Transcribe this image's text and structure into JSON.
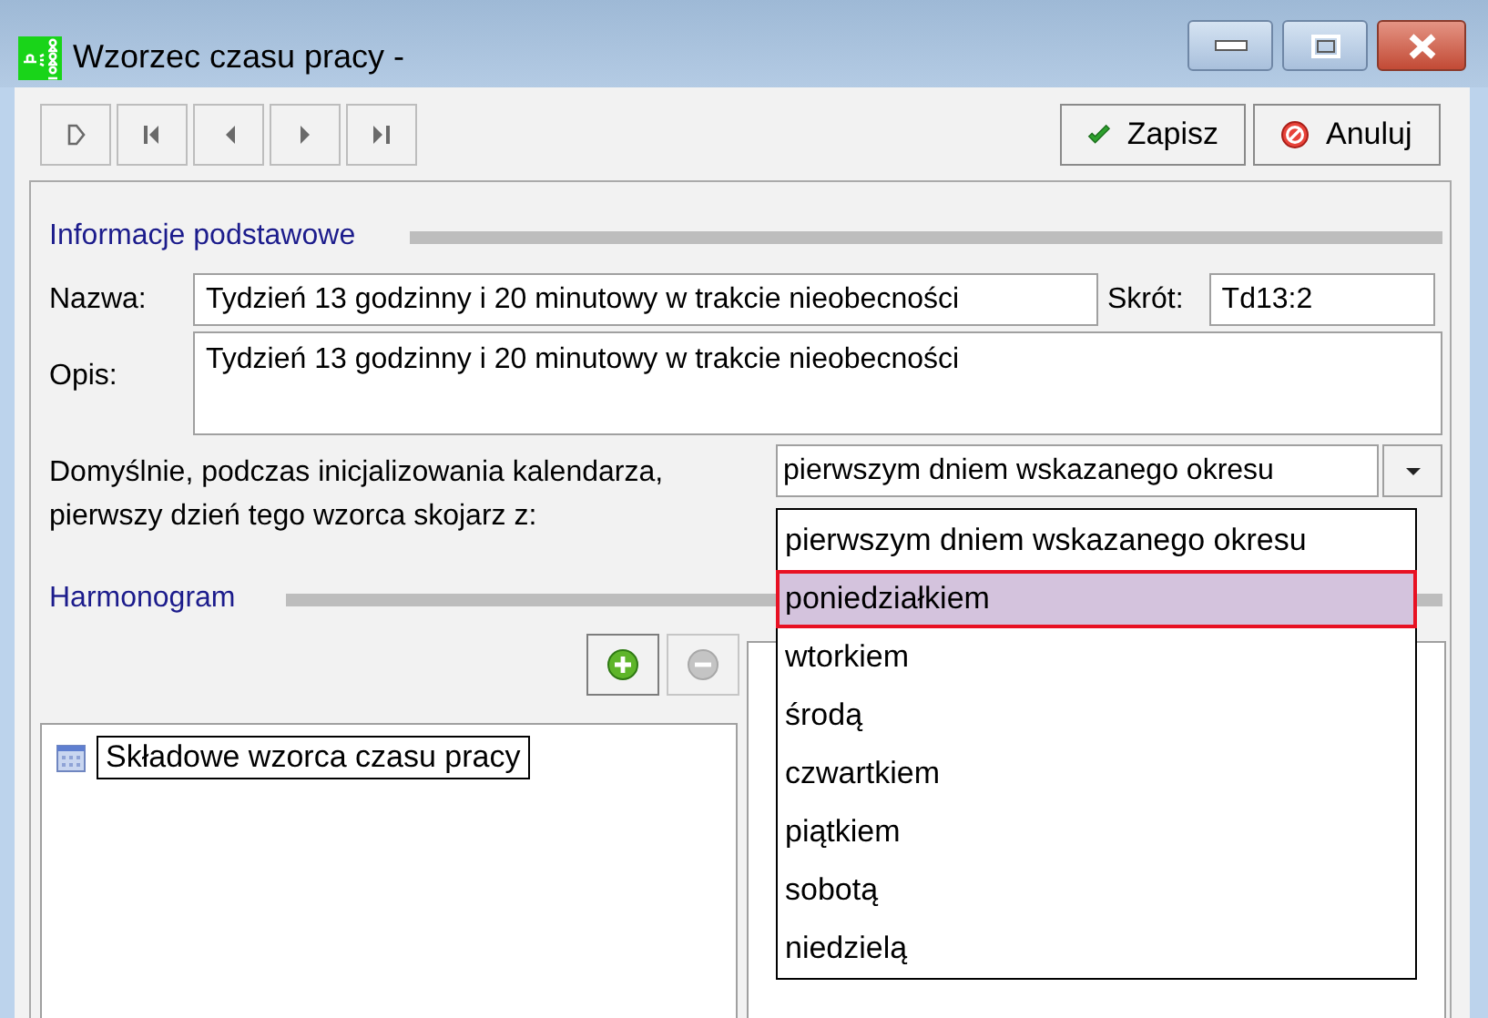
{
  "window": {
    "title": "Wzorzec czasu pracy -"
  },
  "toolbar": {
    "nav_buttons": [
      {
        "kind": "new"
      },
      {
        "kind": "first"
      },
      {
        "kind": "prev"
      },
      {
        "kind": "next"
      },
      {
        "kind": "last"
      }
    ],
    "actions": [
      {
        "label": "Zapisz",
        "kind": "save"
      },
      {
        "label": "Anuluj",
        "kind": "cancel"
      }
    ]
  },
  "basic_info": {
    "heading": "Informacje podstawowe",
    "name_label": "Nazwa:",
    "name_value": "Tydzień 13 godzinny i 20 minutowy w trakcie nieobecności",
    "short_label": "Skrót:",
    "short_value": "Td13:2",
    "description_label": "Opis:",
    "description_value": "Tydzień 13 godzinny i 20 minutowy w trakcie nieobecności",
    "default_label_lines": [
      "Domyślnie, podczas inicjalizowania kalendarza,",
      "pierwszy dzień tego wzorca skojarz z:"
    ],
    "default_combo": {
      "value": "pierwszym dniem wskazanego okresu",
      "options": [
        {
          "label": "pierwszym dniem wskazanego okresu",
          "highlighted": false
        },
        {
          "label": "poniedziałkiem",
          "highlighted": true
        },
        {
          "label": "wtorkiem",
          "highlighted": false
        },
        {
          "label": "środą",
          "highlighted": false
        },
        {
          "label": "czwartkiem",
          "highlighted": false
        },
        {
          "label": "piątkiem",
          "highlighted": false
        },
        {
          "label": "sobotą",
          "highlighted": false
        },
        {
          "label": "niedzielą",
          "highlighted": false
        }
      ]
    }
  },
  "schedule": {
    "heading": "Harmonogram",
    "tools": [
      {
        "kind": "add",
        "disabled": false
      },
      {
        "kind": "remove",
        "disabled": true
      }
    ],
    "tree": [
      {
        "label": "Składowe wzorca czasu pracy",
        "selected": true
      }
    ]
  }
}
